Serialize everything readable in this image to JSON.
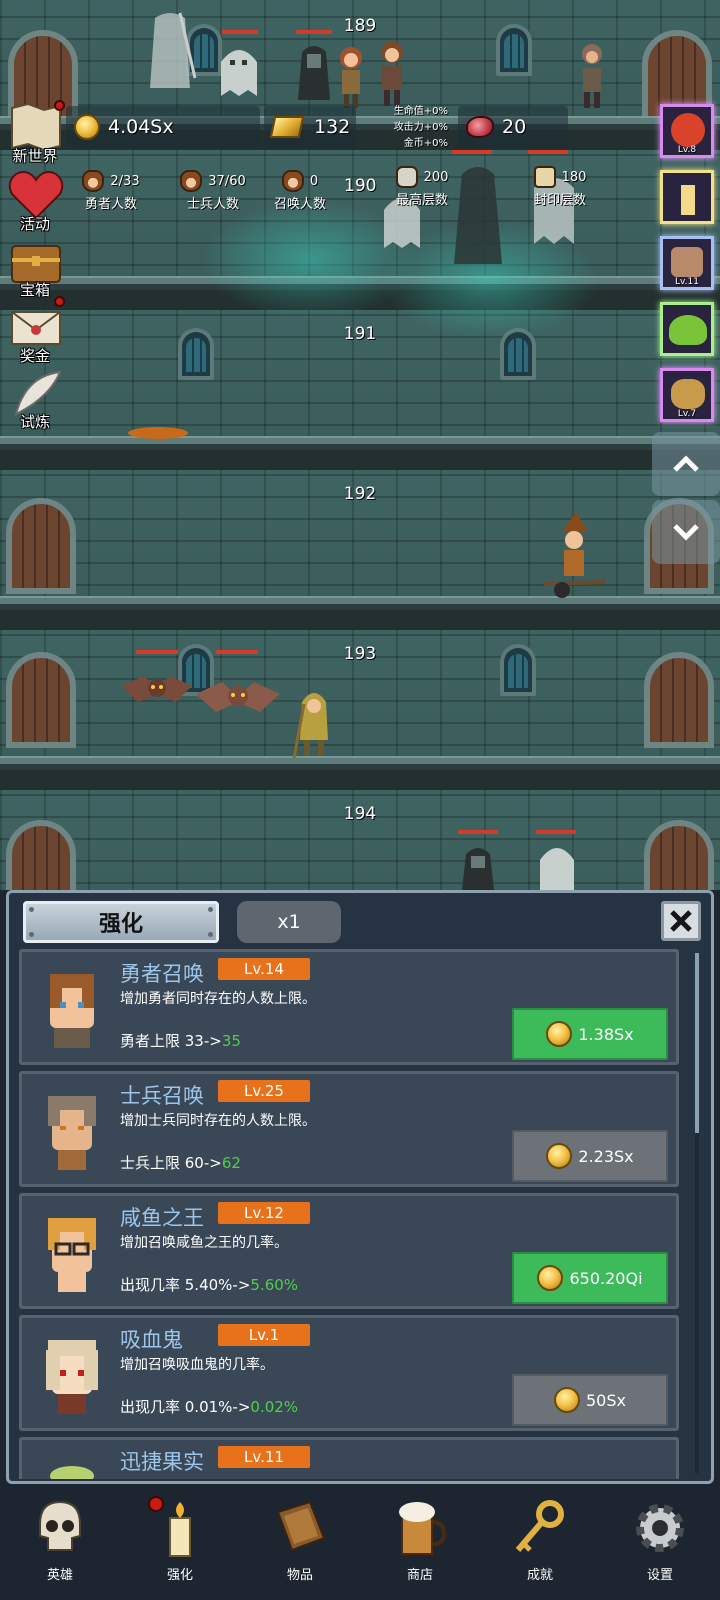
{
  "resources": {
    "gold": "4.04Sx",
    "gold_bars": "132",
    "meat": "20"
  },
  "bonuses": [
    "生命值+0%",
    "攻击力+0%",
    "金币+0%"
  ],
  "counts": [
    {
      "value": "2/33",
      "label": "勇者人数"
    },
    {
      "value": "37/60",
      "label": "士兵人数"
    },
    {
      "value": "0",
      "label": "召唤人数"
    }
  ],
  "floor_records": [
    {
      "value": "200",
      "label": "最高层数"
    },
    {
      "value": "180",
      "label": "封印层数"
    }
  ],
  "floors": [
    "189",
    "190",
    "191",
    "192",
    "193",
    "194"
  ],
  "left_menu": [
    "新世界",
    "活动",
    "宝箱",
    "奖金",
    "试炼"
  ],
  "right_items": [
    {
      "lv": "Lv.8",
      "color": "#d8432a"
    },
    {
      "lv": "",
      "color": "#f3d98a"
    },
    {
      "lv": "Lv.11",
      "color": "#b88a6a"
    },
    {
      "lv": "",
      "color": "#7ac43a"
    },
    {
      "lv": "Lv.7",
      "color": "#c79b4a"
    }
  ],
  "panel": {
    "tab_active": "强化",
    "tab_multiplier": "x1",
    "cards": [
      {
        "name": "勇者召唤",
        "level": "Lv.14",
        "desc": "增加勇者同时存在的人数上限。",
        "stat_prefix": "勇者上限 33->",
        "stat_new": "35",
        "price": "1.38Sx",
        "affordable": true,
        "hair": "#9a5a2a",
        "skin": "#f2c39a"
      },
      {
        "name": "士兵召唤",
        "level": "Lv.25",
        "desc": "增加士兵同时存在的人数上限。",
        "stat_prefix": "士兵上限 60->",
        "stat_new": "62",
        "price": "2.23Sx",
        "affordable": false,
        "hair": "#8a7a6a",
        "skin": "#e6b48a"
      },
      {
        "name": "咸鱼之王",
        "level": "Lv.12",
        "desc": "增加召唤咸鱼之王的几率。",
        "stat_prefix": "出现几率 5.40%->",
        "stat_new": "5.60%",
        "price": "650.20Qi",
        "affordable": true,
        "hair": "#e0a040",
        "skin": "#f2c39a"
      },
      {
        "name": "吸血鬼",
        "level": "Lv.1",
        "desc": "增加召唤吸血鬼的几率。",
        "stat_prefix": "出现几率 0.01%->",
        "stat_new": "0.02%",
        "price": "50Sx",
        "affordable": false,
        "hair": "#e0d0b0",
        "skin": "#f6dcc0"
      },
      {
        "name": "迅捷果实",
        "level": "Lv.11",
        "desc": "",
        "stat_prefix": "",
        "stat_new": "",
        "price": "",
        "affordable": false,
        "hair": "#6a8a3a",
        "skin": "#b8d070"
      }
    ]
  },
  "bottom_nav": [
    "英雄",
    "强化",
    "物品",
    "商店",
    "成就",
    "设置"
  ],
  "colors": {
    "accent_green": "#3dba5a",
    "level_orange": "#e8721c",
    "name_blue": "#9ec6ea",
    "new_value_green": "#4fd04a"
  }
}
